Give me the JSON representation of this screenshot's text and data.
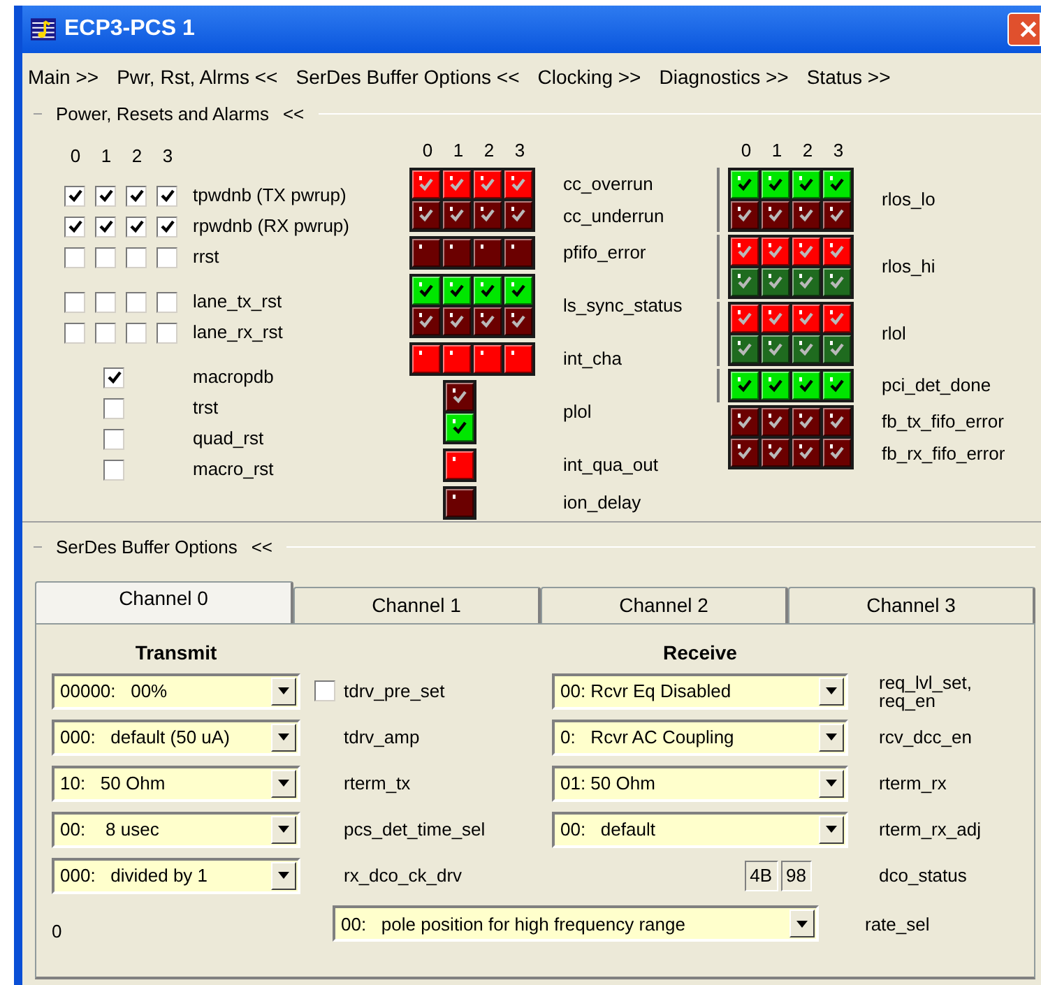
{
  "window": {
    "title": "ECP3-PCS 1"
  },
  "menu": [
    {
      "label": "Main >>"
    },
    {
      "label": "Pwr, Rst, Alrms <<"
    },
    {
      "label": "SerDes Buffer Options <<"
    },
    {
      "label": "Clocking >>"
    },
    {
      "label": "Diagnostics >>"
    },
    {
      "label": "Status >>"
    }
  ],
  "power": {
    "title": "Power, Resets and Alarms",
    "toggle": "<<",
    "reset_columns": [
      "0",
      "1",
      "2",
      "3"
    ],
    "reset_groups": [
      [
        {
          "label": "tpwdnb (TX pwrup)",
          "boxes": [
            {
              "checked": true
            },
            {
              "checked": true
            },
            {
              "checked": true
            },
            {
              "checked": true
            }
          ]
        },
        {
          "label": "rpwdnb (RX pwrup)",
          "boxes": [
            {
              "checked": true
            },
            {
              "checked": true
            },
            {
              "checked": true
            },
            {
              "checked": true
            }
          ]
        },
        {
          "label": "rrst",
          "boxes": [
            {
              "checked": false
            },
            {
              "checked": false
            },
            {
              "checked": false
            },
            {
              "checked": false
            }
          ]
        }
      ],
      [
        {
          "label": "lane_tx_rst",
          "boxes": [
            {
              "checked": false
            },
            {
              "checked": false
            },
            {
              "checked": false
            },
            {
              "checked": false
            }
          ]
        },
        {
          "label": "lane_rx_rst",
          "boxes": [
            {
              "checked": false
            },
            {
              "checked": false
            },
            {
              "checked": false
            },
            {
              "checked": false
            }
          ]
        }
      ],
      [
        {
          "label": "macropdb",
          "boxes": [
            {
              "checked": true
            }
          ]
        },
        {
          "label": "trst",
          "boxes": [
            {
              "checked": false
            }
          ]
        },
        {
          "label": "quad_rst",
          "boxes": [
            {
              "checked": false
            }
          ]
        },
        {
          "label": "macro_rst",
          "boxes": [
            {
              "checked": false
            }
          ]
        }
      ]
    ],
    "middle_columns": [
      "0",
      "1",
      "2",
      "3"
    ],
    "middle_leds": [
      {
        "labels": [
          "cc_overrun",
          "cc_underrun"
        ],
        "rows": [
          [
            {
              "color": "#ff0000",
              "checked": true
            },
            {
              "color": "#ff0000",
              "checked": true
            },
            {
              "color": "#ff0000",
              "checked": true
            },
            {
              "color": "#ff0000",
              "checked": true
            }
          ],
          [
            {
              "color": "#6b0000",
              "checked": true
            },
            {
              "color": "#6b0000",
              "checked": true
            },
            {
              "color": "#6b0000",
              "checked": true
            },
            {
              "color": "#6b0000",
              "checked": true
            }
          ]
        ]
      },
      {
        "labels": [
          "pfifo_error"
        ],
        "rows": [
          [
            {
              "color": "#6b0000",
              "checked": false
            },
            {
              "color": "#6b0000",
              "checked": false
            },
            {
              "color": "#6b0000",
              "checked": false
            },
            {
              "color": "#6b0000",
              "checked": false
            }
          ]
        ]
      },
      {
        "labels": [
          "ls_sync_status"
        ],
        "rows": [
          [
            {
              "color": "#00e600",
              "checked": true
            },
            {
              "color": "#00e600",
              "checked": true
            },
            {
              "color": "#00e600",
              "checked": true
            },
            {
              "color": "#00e600",
              "checked": true
            }
          ],
          [
            {
              "color": "#6b0000",
              "checked": true
            },
            {
              "color": "#6b0000",
              "checked": true
            },
            {
              "color": "#6b0000",
              "checked": true
            },
            {
              "color": "#6b0000",
              "checked": true
            }
          ]
        ]
      },
      {
        "labels": [
          "int_cha"
        ],
        "rows": [
          [
            {
              "color": "#ff0000",
              "checked": false
            },
            {
              "color": "#ff0000",
              "checked": false
            },
            {
              "color": "#ff0000",
              "checked": false
            },
            {
              "color": "#ff0000",
              "checked": false
            }
          ]
        ]
      },
      {
        "labels": [
          "plol"
        ],
        "rows": [
          [
            {
              "color": "#6b0000",
              "checked": true
            }
          ],
          [
            {
              "color": "#00e600",
              "checked": true
            }
          ]
        ]
      },
      {
        "labels": [
          "int_qua_out"
        ],
        "rows": [
          [
            {
              "color": "#ff0000",
              "checked": false
            }
          ]
        ]
      },
      {
        "labels": [
          "ion_delay"
        ],
        "rows": [
          [
            {
              "color": "#6b0000",
              "checked": false
            }
          ]
        ]
      }
    ],
    "right_columns": [
      "0",
      "1",
      "2",
      "3"
    ],
    "right_leds": [
      {
        "marked": true,
        "labels": [
          "rlos_lo"
        ],
        "rows": [
          [
            {
              "color": "#00e600",
              "checked": true
            },
            {
              "color": "#00e600",
              "checked": true
            },
            {
              "color": "#00e600",
              "checked": true
            },
            {
              "color": "#00e600",
              "checked": true
            }
          ],
          [
            {
              "color": "#6b0000",
              "checked": true
            },
            {
              "color": "#6b0000",
              "checked": true
            },
            {
              "color": "#6b0000",
              "checked": true
            },
            {
              "color": "#6b0000",
              "checked": true
            }
          ]
        ]
      },
      {
        "marked": true,
        "labels": [
          "rlos_hi"
        ],
        "rows": [
          [
            {
              "color": "#ff0000",
              "checked": true
            },
            {
              "color": "#ff0000",
              "checked": true
            },
            {
              "color": "#ff0000",
              "checked": true
            },
            {
              "color": "#ff0000",
              "checked": true
            }
          ],
          [
            {
              "color": "#1f6b1f",
              "checked": true
            },
            {
              "color": "#1f6b1f",
              "checked": true
            },
            {
              "color": "#1f6b1f",
              "checked": true
            },
            {
              "color": "#1f6b1f",
              "checked": true
            }
          ]
        ]
      },
      {
        "marked": true,
        "labels": [
          "rlol"
        ],
        "rows": [
          [
            {
              "color": "#ff0000",
              "checked": true
            },
            {
              "color": "#ff0000",
              "checked": true
            },
            {
              "color": "#ff0000",
              "checked": true
            },
            {
              "color": "#ff0000",
              "checked": true
            }
          ],
          [
            {
              "color": "#1f6b1f",
              "checked": true
            },
            {
              "color": "#1f6b1f",
              "checked": true
            },
            {
              "color": "#1f6b1f",
              "checked": true
            },
            {
              "color": "#1f6b1f",
              "checked": true
            }
          ]
        ]
      },
      {
        "marked": true,
        "labels": [
          "pci_det_done"
        ],
        "rows": [
          [
            {
              "color": "#00e600",
              "checked": true
            },
            {
              "color": "#00e600",
              "checked": true
            },
            {
              "color": "#00e600",
              "checked": true
            },
            {
              "color": "#00e600",
              "checked": true
            }
          ]
        ]
      },
      {
        "marked": false,
        "labels": [
          "fb_tx_fifo_error",
          "fb_rx_fifo_error"
        ],
        "rows": [
          [
            {
              "color": "#6b0000",
              "checked": true
            },
            {
              "color": "#6b0000",
              "checked": true
            },
            {
              "color": "#6b0000",
              "checked": true
            },
            {
              "color": "#6b0000",
              "checked": true
            }
          ],
          [
            {
              "color": "#6b0000",
              "checked": true
            },
            {
              "color": "#6b0000",
              "checked": true
            },
            {
              "color": "#6b0000",
              "checked": true
            },
            {
              "color": "#6b0000",
              "checked": true
            }
          ]
        ]
      }
    ]
  },
  "serdes": {
    "title": "SerDes Buffer Options",
    "toggle": "<<",
    "tabs": [
      {
        "label": "Channel 0",
        "selected": true
      },
      {
        "label": "Channel 1",
        "selected": false
      },
      {
        "label": "Channel 2",
        "selected": false
      },
      {
        "label": "Channel 3",
        "selected": false
      }
    ],
    "transmit_heading": "Transmit",
    "receive_heading": "Receive",
    "transmit": [
      {
        "kind": "checkbox_select",
        "value": "00000:   00%",
        "checked": false,
        "label": "tdrv_pre_set"
      },
      {
        "kind": "select",
        "value": "000:   default (50 uA)",
        "label": "tdrv_amp"
      },
      {
        "kind": "select",
        "value": "10:   50 Ohm",
        "label": "rterm_tx"
      },
      {
        "kind": "select",
        "value": "00:    8 usec",
        "label": "pcs_det_time_sel"
      },
      {
        "kind": "select",
        "value": "000:   divided by 1",
        "label": "rx_dco_ck_drv"
      }
    ],
    "receive": [
      {
        "kind": "select",
        "value": "00: Rcvr Eq Disabled",
        "label": "req_lvl_set,\nreq_en"
      },
      {
        "kind": "select",
        "value": "0:   Rcvr AC Coupling",
        "label": "rcv_dcc_en"
      },
      {
        "kind": "select",
        "value": "01: 50 Ohm",
        "label": "rterm_rx"
      },
      {
        "kind": "select",
        "value": "00:   default",
        "label": "rterm_rx_adj"
      },
      {
        "kind": "readouts",
        "values": [
          "4B",
          "98"
        ],
        "label": "dco_status"
      }
    ],
    "counter": "0",
    "rate": {
      "value": "00:   pole position for high frequency range",
      "label": "rate_sel"
    }
  }
}
